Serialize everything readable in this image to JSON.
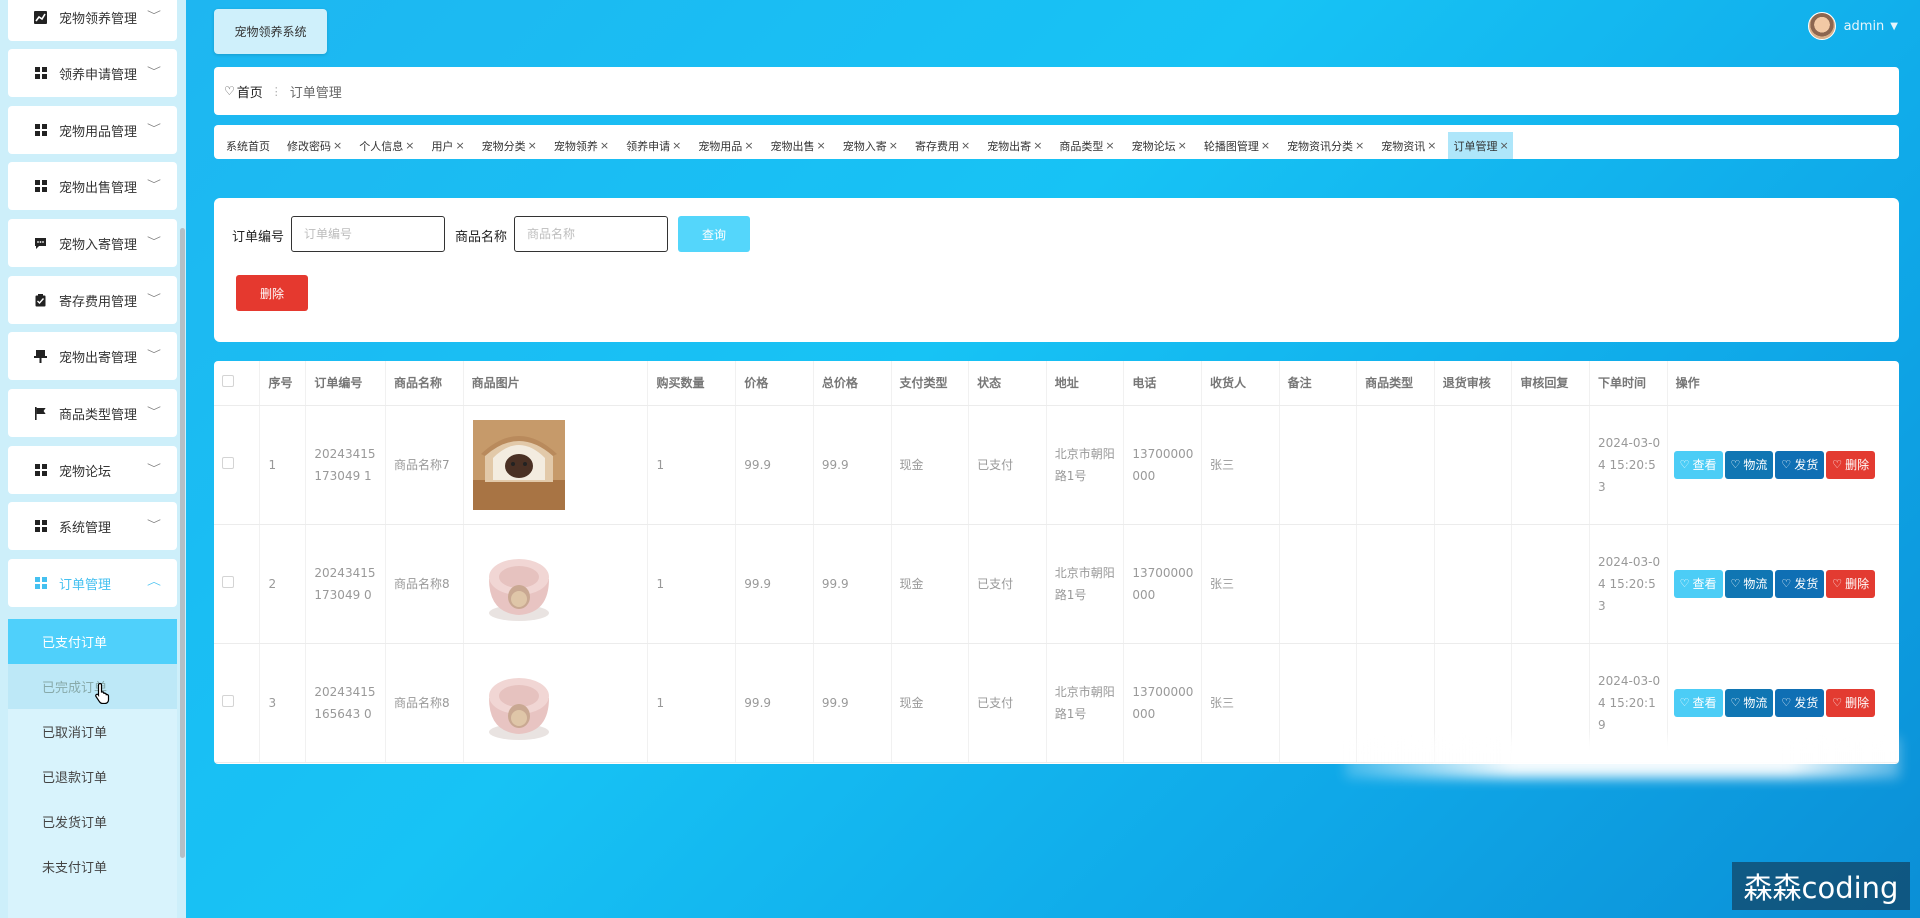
{
  "sidebar": {
    "menu": [
      {
        "label": "宠物领养管理",
        "icon": "chart-icon"
      },
      {
        "label": "领养申请管理",
        "icon": "grid-icon"
      },
      {
        "label": "宠物用品管理",
        "icon": "grid-icon"
      },
      {
        "label": "宠物出售管理",
        "icon": "grid-icon"
      },
      {
        "label": "宠物入寄管理",
        "icon": "chat-icon"
      },
      {
        "label": "寄存费用管理",
        "icon": "clipboard-icon"
      },
      {
        "label": "宠物出寄管理",
        "icon": "pin-icon"
      },
      {
        "label": "商品类型管理",
        "icon": "flag-icon"
      },
      {
        "label": "宠物论坛",
        "icon": "grid-icon"
      },
      {
        "label": "系统管理",
        "icon": "grid-icon"
      },
      {
        "label": "订单管理",
        "icon": "grid-icon"
      }
    ],
    "submenu": [
      "已支付订单",
      "已完成订单",
      "已取消订单",
      "已退款订单",
      "已发货订单",
      "未支付订单"
    ]
  },
  "header": {
    "brand": "宠物领养系统",
    "username": "admin"
  },
  "breadcrumb": {
    "home": "首页",
    "current": "订单管理"
  },
  "tags": [
    {
      "label": "系统首页",
      "closable": false
    },
    {
      "label": "修改密码",
      "closable": true
    },
    {
      "label": "个人信息",
      "closable": true
    },
    {
      "label": "用户",
      "closable": true
    },
    {
      "label": "宠物分类",
      "closable": true
    },
    {
      "label": "宠物领养",
      "closable": true
    },
    {
      "label": "领养申请",
      "closable": true
    },
    {
      "label": "宠物用品",
      "closable": true
    },
    {
      "label": "宠物出售",
      "closable": true
    },
    {
      "label": "宠物入寄",
      "closable": true
    },
    {
      "label": "寄存费用",
      "closable": true
    },
    {
      "label": "宠物出寄",
      "closable": true
    },
    {
      "label": "商品类型",
      "closable": true
    },
    {
      "label": "宠物论坛",
      "closable": true
    },
    {
      "label": "轮播图管理",
      "closable": true
    },
    {
      "label": "宠物资讯分类",
      "closable": true
    },
    {
      "label": "宠物资讯",
      "closable": true
    },
    {
      "label": "订单管理",
      "closable": true
    }
  ],
  "search": {
    "order_no_label": "订单编号",
    "order_no_placeholder": "订单编号",
    "product_label": "商品名称",
    "product_placeholder": "商品名称",
    "query_label": "查询",
    "delete_label": "删除"
  },
  "table": {
    "columns": [
      "序号",
      "订单编号",
      "商品名称",
      "商品图片",
      "购买数量",
      "价格",
      "总价格",
      "支付类型",
      "状态",
      "地址",
      "电话",
      "收货人",
      "备注",
      "商品类型",
      "退货审核",
      "审核回复",
      "下单时间",
      "操作"
    ],
    "actions": {
      "view": "查看",
      "logistics": "物流",
      "ship": "发货",
      "delete": "删除"
    },
    "rows": [
      {
        "index": "1",
        "order_no": "20243415173049 1",
        "product": "商品名称7",
        "image": "pet-house-image",
        "qty": "1",
        "price": "99.9",
        "total": "99.9",
        "pay_type": "现金",
        "status": "已支付",
        "address": "北京市朝阳路1号",
        "phone": "13700000000",
        "receiver": "张三",
        "remark": "",
        "product_type": "",
        "return_review": "",
        "review_reply": "",
        "order_time": "2024-03-04 15:20:53"
      },
      {
        "index": "2",
        "order_no": "20243415173049 0",
        "product": "商品名称8",
        "image": "pet-bed-image",
        "qty": "1",
        "price": "99.9",
        "total": "99.9",
        "pay_type": "现金",
        "status": "已支付",
        "address": "北京市朝阳路1号",
        "phone": "13700000000",
        "receiver": "张三",
        "remark": "",
        "product_type": "",
        "return_review": "",
        "review_reply": "",
        "order_time": "2024-03-04 15:20:53"
      },
      {
        "index": "3",
        "order_no": "20243415165643 0",
        "product": "商品名称8",
        "image": "pet-bed-image",
        "qty": "1",
        "price": "99.9",
        "total": "99.9",
        "pay_type": "现金",
        "status": "已支付",
        "address": "北京市朝阳路1号",
        "phone": "13700000000",
        "receiver": "张三",
        "remark": "",
        "product_type": "",
        "return_review": "",
        "review_reply": "",
        "order_time": "2024-03-04 15:20:19"
      }
    ]
  },
  "watermark": "森森coding",
  "colors": {
    "accent": "#4fd0fb",
    "danger": "#e5392f",
    "logistics": "#1076b3"
  }
}
